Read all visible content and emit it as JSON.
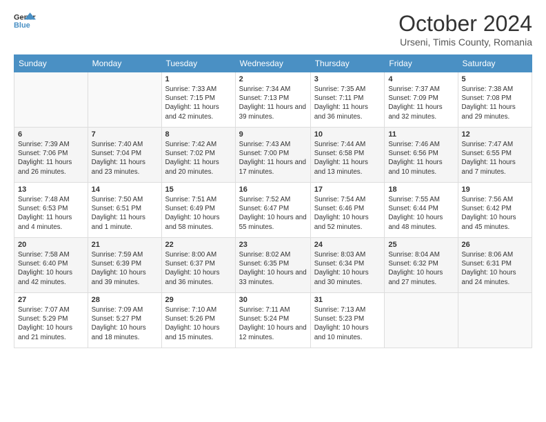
{
  "header": {
    "logo_line1": "General",
    "logo_line2": "Blue",
    "title": "October 2024",
    "subtitle": "Urseni, Timis County, Romania"
  },
  "weekdays": [
    "Sunday",
    "Monday",
    "Tuesday",
    "Wednesday",
    "Thursday",
    "Friday",
    "Saturday"
  ],
  "weeks": [
    [
      {
        "day": "",
        "sunrise": "",
        "sunset": "",
        "daylight": ""
      },
      {
        "day": "",
        "sunrise": "",
        "sunset": "",
        "daylight": ""
      },
      {
        "day": "1",
        "sunrise": "Sunrise: 7:33 AM",
        "sunset": "Sunset: 7:15 PM",
        "daylight": "Daylight: 11 hours and 42 minutes."
      },
      {
        "day": "2",
        "sunrise": "Sunrise: 7:34 AM",
        "sunset": "Sunset: 7:13 PM",
        "daylight": "Daylight: 11 hours and 39 minutes."
      },
      {
        "day": "3",
        "sunrise": "Sunrise: 7:35 AM",
        "sunset": "Sunset: 7:11 PM",
        "daylight": "Daylight: 11 hours and 36 minutes."
      },
      {
        "day": "4",
        "sunrise": "Sunrise: 7:37 AM",
        "sunset": "Sunset: 7:09 PM",
        "daylight": "Daylight: 11 hours and 32 minutes."
      },
      {
        "day": "5",
        "sunrise": "Sunrise: 7:38 AM",
        "sunset": "Sunset: 7:08 PM",
        "daylight": "Daylight: 11 hours and 29 minutes."
      }
    ],
    [
      {
        "day": "6",
        "sunrise": "Sunrise: 7:39 AM",
        "sunset": "Sunset: 7:06 PM",
        "daylight": "Daylight: 11 hours and 26 minutes."
      },
      {
        "day": "7",
        "sunrise": "Sunrise: 7:40 AM",
        "sunset": "Sunset: 7:04 PM",
        "daylight": "Daylight: 11 hours and 23 minutes."
      },
      {
        "day": "8",
        "sunrise": "Sunrise: 7:42 AM",
        "sunset": "Sunset: 7:02 PM",
        "daylight": "Daylight: 11 hours and 20 minutes."
      },
      {
        "day": "9",
        "sunrise": "Sunrise: 7:43 AM",
        "sunset": "Sunset: 7:00 PM",
        "daylight": "Daylight: 11 hours and 17 minutes."
      },
      {
        "day": "10",
        "sunrise": "Sunrise: 7:44 AM",
        "sunset": "Sunset: 6:58 PM",
        "daylight": "Daylight: 11 hours and 13 minutes."
      },
      {
        "day": "11",
        "sunrise": "Sunrise: 7:46 AM",
        "sunset": "Sunset: 6:56 PM",
        "daylight": "Daylight: 11 hours and 10 minutes."
      },
      {
        "day": "12",
        "sunrise": "Sunrise: 7:47 AM",
        "sunset": "Sunset: 6:55 PM",
        "daylight": "Daylight: 11 hours and 7 minutes."
      }
    ],
    [
      {
        "day": "13",
        "sunrise": "Sunrise: 7:48 AM",
        "sunset": "Sunset: 6:53 PM",
        "daylight": "Daylight: 11 hours and 4 minutes."
      },
      {
        "day": "14",
        "sunrise": "Sunrise: 7:50 AM",
        "sunset": "Sunset: 6:51 PM",
        "daylight": "Daylight: 11 hours and 1 minute."
      },
      {
        "day": "15",
        "sunrise": "Sunrise: 7:51 AM",
        "sunset": "Sunset: 6:49 PM",
        "daylight": "Daylight: 10 hours and 58 minutes."
      },
      {
        "day": "16",
        "sunrise": "Sunrise: 7:52 AM",
        "sunset": "Sunset: 6:47 PM",
        "daylight": "Daylight: 10 hours and 55 minutes."
      },
      {
        "day": "17",
        "sunrise": "Sunrise: 7:54 AM",
        "sunset": "Sunset: 6:46 PM",
        "daylight": "Daylight: 10 hours and 52 minutes."
      },
      {
        "day": "18",
        "sunrise": "Sunrise: 7:55 AM",
        "sunset": "Sunset: 6:44 PM",
        "daylight": "Daylight: 10 hours and 48 minutes."
      },
      {
        "day": "19",
        "sunrise": "Sunrise: 7:56 AM",
        "sunset": "Sunset: 6:42 PM",
        "daylight": "Daylight: 10 hours and 45 minutes."
      }
    ],
    [
      {
        "day": "20",
        "sunrise": "Sunrise: 7:58 AM",
        "sunset": "Sunset: 6:40 PM",
        "daylight": "Daylight: 10 hours and 42 minutes."
      },
      {
        "day": "21",
        "sunrise": "Sunrise: 7:59 AM",
        "sunset": "Sunset: 6:39 PM",
        "daylight": "Daylight: 10 hours and 39 minutes."
      },
      {
        "day": "22",
        "sunrise": "Sunrise: 8:00 AM",
        "sunset": "Sunset: 6:37 PM",
        "daylight": "Daylight: 10 hours and 36 minutes."
      },
      {
        "day": "23",
        "sunrise": "Sunrise: 8:02 AM",
        "sunset": "Sunset: 6:35 PM",
        "daylight": "Daylight: 10 hours and 33 minutes."
      },
      {
        "day": "24",
        "sunrise": "Sunrise: 8:03 AM",
        "sunset": "Sunset: 6:34 PM",
        "daylight": "Daylight: 10 hours and 30 minutes."
      },
      {
        "day": "25",
        "sunrise": "Sunrise: 8:04 AM",
        "sunset": "Sunset: 6:32 PM",
        "daylight": "Daylight: 10 hours and 27 minutes."
      },
      {
        "day": "26",
        "sunrise": "Sunrise: 8:06 AM",
        "sunset": "Sunset: 6:31 PM",
        "daylight": "Daylight: 10 hours and 24 minutes."
      }
    ],
    [
      {
        "day": "27",
        "sunrise": "Sunrise: 7:07 AM",
        "sunset": "Sunset: 5:29 PM",
        "daylight": "Daylight: 10 hours and 21 minutes."
      },
      {
        "day": "28",
        "sunrise": "Sunrise: 7:09 AM",
        "sunset": "Sunset: 5:27 PM",
        "daylight": "Daylight: 10 hours and 18 minutes."
      },
      {
        "day": "29",
        "sunrise": "Sunrise: 7:10 AM",
        "sunset": "Sunset: 5:26 PM",
        "daylight": "Daylight: 10 hours and 15 minutes."
      },
      {
        "day": "30",
        "sunrise": "Sunrise: 7:11 AM",
        "sunset": "Sunset: 5:24 PM",
        "daylight": "Daylight: 10 hours and 12 minutes."
      },
      {
        "day": "31",
        "sunrise": "Sunrise: 7:13 AM",
        "sunset": "Sunset: 5:23 PM",
        "daylight": "Daylight: 10 hours and 10 minutes."
      },
      {
        "day": "",
        "sunrise": "",
        "sunset": "",
        "daylight": ""
      },
      {
        "day": "",
        "sunrise": "",
        "sunset": "",
        "daylight": ""
      }
    ]
  ]
}
